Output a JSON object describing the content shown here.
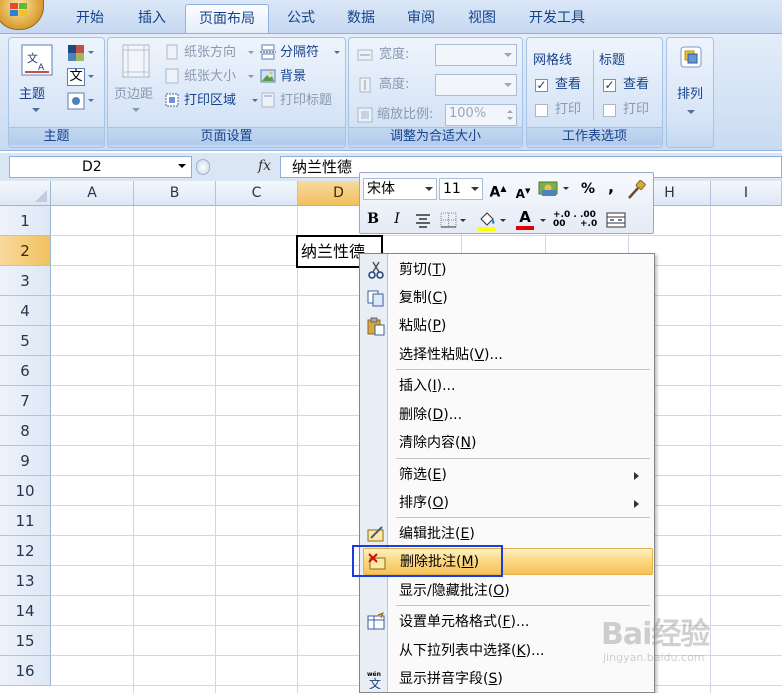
{
  "ribbon_tabs": [
    "开始",
    "插入",
    "页面布局",
    "公式",
    "数据",
    "审阅",
    "视图",
    "开发工具"
  ],
  "active_tab": "页面布局",
  "groups": {
    "theme": {
      "label": "主题",
      "theme_button": "主题",
      "colors_icon": "theme-colors-icon",
      "fonts_icon_text": "文",
      "effects_icon": "theme-effects-icon"
    },
    "page_setup": {
      "label": "页面设置",
      "margins": "页边距",
      "orientation": "纸张方向",
      "size": "纸张大小",
      "print_area": "打印区域",
      "breaks": "分隔符",
      "background": "背景",
      "print_titles": "打印标题"
    },
    "scale_to_fit": {
      "label": "调整为合适大小",
      "width": "宽度:",
      "height": "高度:",
      "scale": "缩放比例:",
      "scale_value": "100%"
    },
    "sheet_options": {
      "label": "工作表选项",
      "gridlines_title": "网格线",
      "headings_title": "标题",
      "view": "查看",
      "print": "打印",
      "gridlines_view_checked": true,
      "gridlines_print_checked": false,
      "headings_view_checked": true,
      "headings_print_checked": false
    },
    "arrange": {
      "label": "排列"
    }
  },
  "formula_bar": {
    "name_box": "D2",
    "fx": "fx",
    "content": "纳兰性德"
  },
  "grid": {
    "columns": [
      "A",
      "B",
      "C",
      "D",
      "E",
      "F",
      "G",
      "H",
      "I"
    ],
    "rows": [
      "1",
      "2",
      "3",
      "4",
      "5",
      "6",
      "7",
      "8",
      "9",
      "10",
      "11",
      "12",
      "13",
      "14",
      "15",
      "16"
    ],
    "selected_column": "D",
    "selected_row": "2",
    "active_cell_text": "纳兰性德"
  },
  "mini_toolbar": {
    "font": "宋体",
    "size": "11",
    "grow_font": "A",
    "shrink_font": "A",
    "percent": "%",
    "comma": ",",
    "bold": "B",
    "italic": "I",
    "font_color_letter": "A",
    "increase_decimal": "+.0 .00",
    "decrease_decimal": ".00 +.0"
  },
  "context_menu": {
    "items": [
      {
        "label": "剪切",
        "key": "T",
        "icon": "cut-icon"
      },
      {
        "label": "复制",
        "key": "C",
        "icon": "copy-icon"
      },
      {
        "label": "粘贴",
        "key": "P",
        "icon": "paste-icon"
      },
      {
        "label": "选择性粘贴",
        "key": "V",
        "suffix": "..."
      },
      {
        "label": "插入",
        "key": "I",
        "suffix": "..."
      },
      {
        "label": "删除",
        "key": "D",
        "suffix": "..."
      },
      {
        "label": "清除内容",
        "key": "N"
      },
      {
        "label": "筛选",
        "key": "E",
        "submenu": true
      },
      {
        "label": "排序",
        "key": "O",
        "submenu": true
      },
      {
        "label": "编辑批注",
        "key": "E",
        "icon": "edit-comment-icon"
      },
      {
        "label": "删除批注",
        "key": "M",
        "icon": "delete-comment-icon",
        "highlighted": true
      },
      {
        "label": "显示/隐藏批注",
        "key": "O"
      },
      {
        "label": "设置单元格格式",
        "key": "F",
        "suffix": "...",
        "icon": "format-cells-icon"
      },
      {
        "label": "从下拉列表中选择",
        "key": "K",
        "suffix": "..."
      },
      {
        "label": "显示拼音字段",
        "key": "S",
        "icon": "phonetic-icon"
      }
    ]
  },
  "watermark": {
    "brand": "Bai经验",
    "url": "jingyan.baidu.com"
  },
  "colors": {
    "ribbon_bg": "#c9dbf2",
    "highlight": "#f6c25a",
    "annotation_box": "#1a3de0",
    "selected_header": "#f1c15f"
  }
}
